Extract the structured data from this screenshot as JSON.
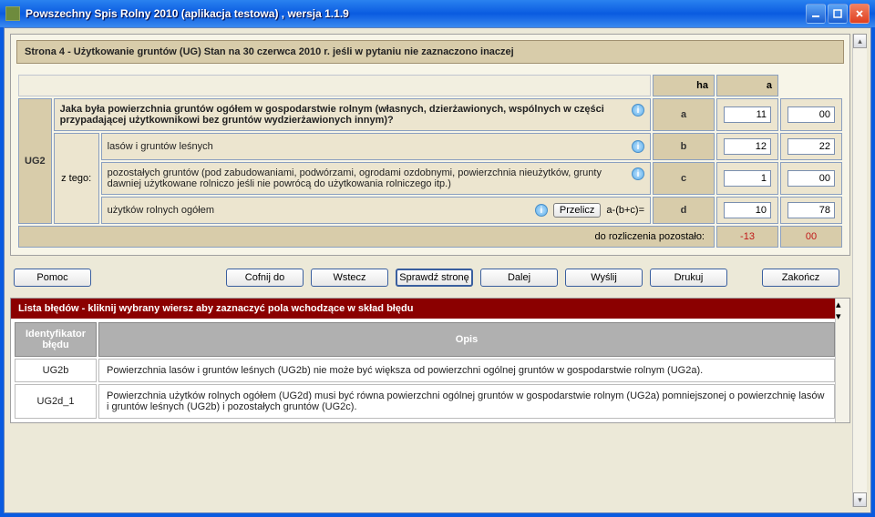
{
  "window": {
    "title": "Powszechny Spis Rolny 2010 (aplikacja testowa)  , wersja 1.1.9"
  },
  "page": {
    "header": "Strona 4 - Użytkowanie gruntów (UG) Stan na 30 czerwca 2010 r. jeśli w pytaniu nie zaznaczono inaczej"
  },
  "cols": {
    "ha": "ha",
    "a": "a"
  },
  "ug2": {
    "code": "UG2",
    "question": "Jaka była powierzchnia gruntów ogółem w gospodarstwie rolnym (własnych, dzierżawionych, wspólnych w części przypadającej użytkownikowi bez gruntów wydzierżawionych innym)?",
    "sublabel": "z tego:",
    "rows": {
      "a": {
        "letter": "a",
        "ha": "11",
        "a": "00"
      },
      "b": {
        "letter": "b",
        "label": "lasów i gruntów leśnych",
        "ha": "12",
        "a": "22"
      },
      "c": {
        "letter": "c",
        "label": "pozostałych gruntów (pod zabudowaniami, podwórzami, ogrodami ozdobnymi, powierzchnia nieużytków, grunty dawniej użytkowane rolniczo jeśli nie powrócą do użytkowania rolniczego itp.)",
        "ha": "1",
        "a": "00"
      },
      "d": {
        "letter": "d",
        "label": "użytków rolnych ogółem",
        "btn": "Przelicz",
        "formula": "a-(b+c)=",
        "ha": "10",
        "a": "78"
      }
    },
    "remaining": {
      "label": "do rozliczenia pozostało:",
      "ha": "-13",
      "a": "00"
    }
  },
  "toolbar": {
    "help": "Pomoc",
    "undo": "Cofnij do",
    "back": "Wstecz",
    "check": "Sprawdź stronę",
    "next": "Dalej",
    "send": "Wyślij",
    "print": "Drukuj",
    "finish": "Zakończ"
  },
  "errors": {
    "banner": "Lista błędów - kliknij wybrany wiersz aby zaznaczyć pola wchodzące w skład błędu",
    "col_id": "Identyfikator błędu",
    "col_desc": "Opis",
    "items": [
      {
        "id": "UG2b",
        "desc": "Powierzchnia lasów i gruntów leśnych (UG2b) nie może być większa od powierzchni ogólnej gruntów w gospodarstwie rolnym (UG2a)."
      },
      {
        "id": "UG2d_1",
        "desc": "Powierzchnia użytków rolnych ogółem (UG2d) musi być równa powierzchni ogólnej gruntów w gospodarstwie rolnym (UG2a) pomniejszonej o powierzchnię lasów i gruntów leśnych (UG2b) i pozostałych gruntów (UG2c)."
      }
    ]
  }
}
